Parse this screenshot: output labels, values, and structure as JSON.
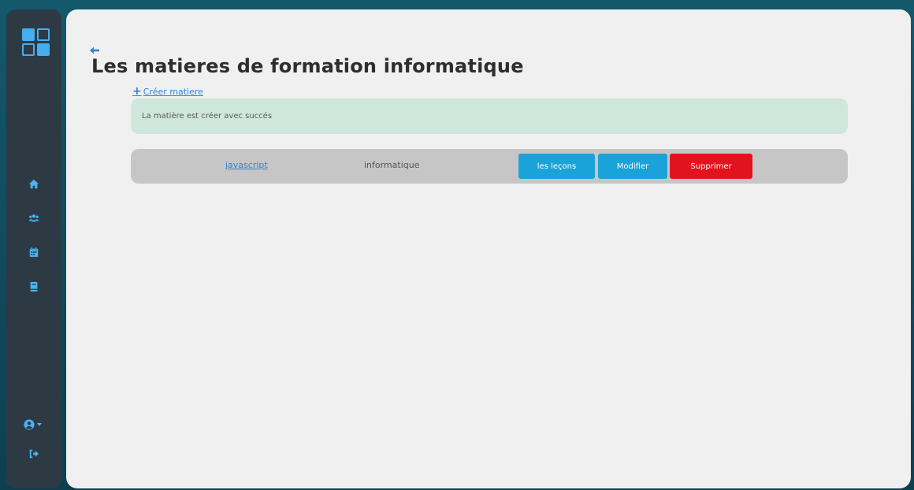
{
  "sidebar": {
    "logo": "app-logo",
    "items": [
      {
        "icon": "home-icon"
      },
      {
        "icon": "users-icon"
      },
      {
        "icon": "calendar-icon"
      },
      {
        "icon": "book-icon"
      }
    ],
    "user_icon": "user-circle-icon",
    "logout_icon": "logout-icon"
  },
  "header": {
    "title": "Les matieres de formation informatique"
  },
  "actions": {
    "create_plus": "+",
    "create_label": "Créer matiere"
  },
  "alert": {
    "message": "La matière est créer avec succés"
  },
  "matieres": [
    {
      "name": "javascript",
      "category": "informatique",
      "lessons_label": "les leçons",
      "edit_label": "Modifier",
      "delete_label": "Supprimer"
    }
  ],
  "colors": {
    "accent": "#1aa3d9",
    "danger": "#e3131d",
    "success_bg": "#cfe6dc",
    "sidebar_bg": "#2d3a44",
    "link": "#2e86de"
  }
}
